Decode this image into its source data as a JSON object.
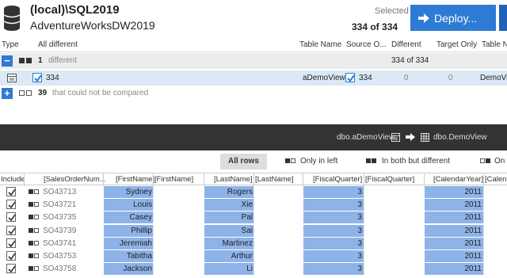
{
  "header": {
    "server": "(local)\\SQL2019",
    "database": "AdventureWorksDW2019",
    "selected_label": "Selected",
    "selected_count": "334 of 334",
    "deploy_label": "Deploy...",
    "icon": "database-icon"
  },
  "columns": {
    "type": "Type",
    "all_different": "All different",
    "table_name": "Table Name",
    "source_object": "Source O...",
    "different": "Different",
    "target_only": "Target Only",
    "table_name_target": "Table N"
  },
  "groups": {
    "different": {
      "count": "1",
      "label": "different",
      "total": "334 of 334"
    },
    "not_compared": {
      "count": "39",
      "label": "that could not be compared"
    }
  },
  "row": {
    "count": "334",
    "table_name": "aDemoView",
    "source_count": "334",
    "different": "0",
    "target_only": "0",
    "target_name": "DemoVi"
  },
  "compare_bar": {
    "source": "dbo.aDemoView",
    "target": "dbo.DemoView"
  },
  "tabs": {
    "all_rows": "All rows",
    "only_left": "Only in left",
    "both_different": "In both but different",
    "only_right": "On"
  },
  "grid": {
    "headers": {
      "include": "Include",
      "sales_order": "[SalesOrderNum...",
      "first_name_l": "[FirstName]",
      "first_name_r": "[FirstName]",
      "last_name_l": "[LastName]",
      "last_name_r": "[LastName]",
      "fiscal_l": "[FiscalQuarter]",
      "fiscal_r": "[FiscalQuarter]",
      "cal_l": "[CalendarYear]",
      "cal_r": "[Calen"
    },
    "rows": [
      {
        "order": "SO43713",
        "first": "Sydney",
        "last": "Rogers",
        "quarter": "3",
        "year": "2011"
      },
      {
        "order": "SO43721",
        "first": "Louis",
        "last": "Xie",
        "quarter": "3",
        "year": "2011"
      },
      {
        "order": "SO43735",
        "first": "Casey",
        "last": "Pal",
        "quarter": "3",
        "year": "2011"
      },
      {
        "order": "SO43739",
        "first": "Phillip",
        "last": "Sai",
        "quarter": "3",
        "year": "2011"
      },
      {
        "order": "SO43741",
        "first": "Jeremiah",
        "last": "Martinez",
        "quarter": "3",
        "year": "2011"
      },
      {
        "order": "SO43753",
        "first": "Tabitha",
        "last": "Arthur",
        "quarter": "3",
        "year": "2011"
      },
      {
        "order": "SO43758",
        "first": "Jackson",
        "last": "Li",
        "quarter": "3",
        "year": "2011"
      }
    ]
  },
  "colors": {
    "accent": "#2e7bd6",
    "selected_row": "#dbe9f6",
    "group_row": "#ececec",
    "dark_bar": "#333333",
    "diff_cell": "#8eb3e8"
  }
}
